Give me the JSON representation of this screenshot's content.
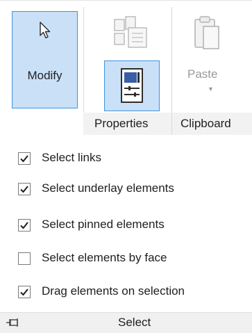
{
  "ribbon": {
    "modify_label": "Modify",
    "properties_panel_label": "Properties",
    "paste_label": "Paste",
    "clipboard_panel_label": "Clipboard",
    "accent_color": "#3f93db",
    "selected_bg": "#c9e0f7"
  },
  "select_menu": {
    "items": [
      {
        "label": "Select links",
        "checked": true
      },
      {
        "label": "Select underlay elements",
        "checked": true
      },
      {
        "label": "Select pinned elements",
        "checked": true
      },
      {
        "label": "Select elements by face",
        "checked": false
      },
      {
        "label": "Drag elements on selection",
        "checked": true
      }
    ],
    "footer_label": "Select"
  },
  "icons": {
    "modify": "cursor-arrow-icon",
    "type_properties": "type-properties-icon",
    "properties": "properties-panel-icon",
    "paste": "paste-icon",
    "pin": "pin-icon"
  }
}
